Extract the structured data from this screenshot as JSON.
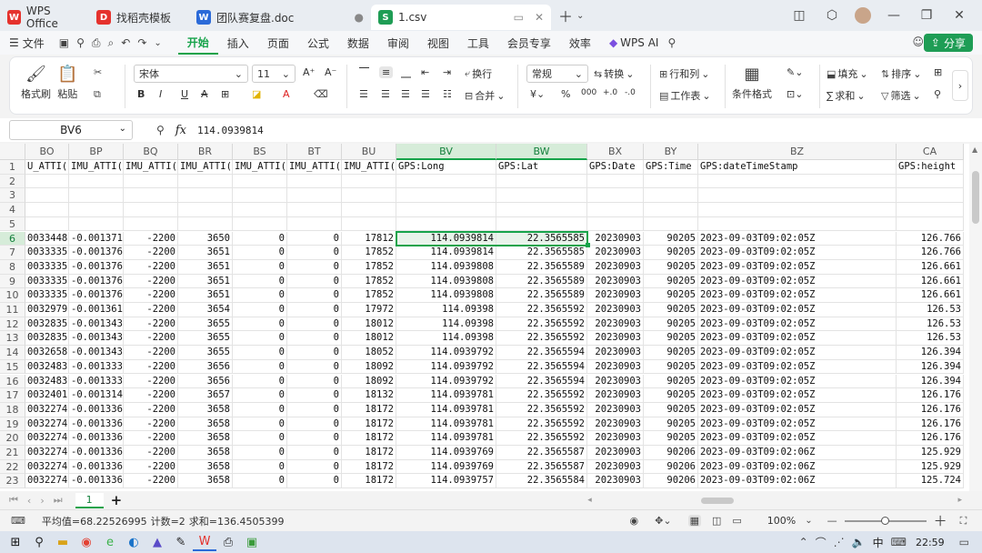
{
  "tabs": [
    {
      "label": "WPS Office",
      "logo": "W",
      "color": "#e5322d"
    },
    {
      "label": "找稻壳模板",
      "logo": "D",
      "color": "#e5322d"
    },
    {
      "label": "团队赛复盘.doc",
      "logo": "W",
      "color": "#2b6ad8"
    },
    {
      "label": "1.csv",
      "logo": "S",
      "color": "#1f9d55"
    }
  ],
  "menubar": {
    "file": "文件",
    "items": [
      "开始",
      "插入",
      "页面",
      "公式",
      "数据",
      "审阅",
      "视图",
      "工具",
      "会员专享",
      "效率"
    ],
    "wps_ai": "WPS AI",
    "share": "分享"
  },
  "ribbon": {
    "format_painter": "格式刷",
    "paste": "粘贴",
    "font_name": "宋体",
    "font_size": "11",
    "wrap": "换行",
    "merge": "合并",
    "number_format": "常规",
    "convert": "转换",
    "rows_cols": "行和列",
    "worksheet": "工作表",
    "cond_format": "条件格式",
    "fill": "填充",
    "sort": "排序",
    "sum": "求和",
    "filter": "筛选"
  },
  "formula": {
    "cell_ref": "BV6",
    "fx": "fx",
    "value": "114.0939814"
  },
  "grid": {
    "columns": [
      "BO",
      "BP",
      "BQ",
      "BR",
      "BS",
      "BT",
      "BU",
      "BV",
      "BW",
      "BX",
      "BY",
      "BZ",
      "CA"
    ],
    "header_row": [
      "U_ATTI(",
      "IMU_ATTI(",
      "IMU_ATTI(",
      "IMU_ATTI(",
      "IMU_ATTI(",
      "IMU_ATTI(",
      "IMU_ATTI(",
      "GPS:Long",
      "GPS:Lat",
      "GPS:Date",
      "GPS:Time",
      "GPS:dateTimeStamp",
      "GPS:height"
    ],
    "row_numbers": [
      "1",
      "2",
      "3",
      "4",
      "5",
      "6",
      "7",
      "8",
      "9",
      "10",
      "11",
      "12",
      "13",
      "14",
      "15",
      "16",
      "17",
      "18",
      "19",
      "20",
      "21",
      "22",
      "23"
    ],
    "rows": [
      [
        "0033448",
        "-0.001371",
        "-2200",
        "3650",
        "0",
        "0",
        "17812",
        "114.0939814",
        "22.3565585",
        "20230903",
        "90205",
        "2023-09-03T09:02:05Z",
        "126.766"
      ],
      [
        "0033335",
        "-0.001376",
        "-2200",
        "3651",
        "0",
        "0",
        "17852",
        "114.0939814",
        "22.3565585",
        "20230903",
        "90205",
        "2023-09-03T09:02:05Z",
        "126.766"
      ],
      [
        "0033335",
        "-0.001376",
        "-2200",
        "3651",
        "0",
        "0",
        "17852",
        "114.0939808",
        "22.3565589",
        "20230903",
        "90205",
        "2023-09-03T09:02:05Z",
        "126.661"
      ],
      [
        "0033335",
        "-0.001376",
        "-2200",
        "3651",
        "0",
        "0",
        "17852",
        "114.0939808",
        "22.3565589",
        "20230903",
        "90205",
        "2023-09-03T09:02:05Z",
        "126.661"
      ],
      [
        "0033335",
        "-0.001376",
        "-2200",
        "3651",
        "0",
        "0",
        "17852",
        "114.0939808",
        "22.3565589",
        "20230903",
        "90205",
        "2023-09-03T09:02:05Z",
        "126.661"
      ],
      [
        "0032979",
        "-0.001361",
        "-2200",
        "3654",
        "0",
        "0",
        "17972",
        "114.09398",
        "22.3565592",
        "20230903",
        "90205",
        "2023-09-03T09:02:05Z",
        "126.53"
      ],
      [
        "0032835",
        "-0.001343",
        "-2200",
        "3655",
        "0",
        "0",
        "18012",
        "114.09398",
        "22.3565592",
        "20230903",
        "90205",
        "2023-09-03T09:02:05Z",
        "126.53"
      ],
      [
        "0032835",
        "-0.001343",
        "-2200",
        "3655",
        "0",
        "0",
        "18012",
        "114.09398",
        "22.3565592",
        "20230903",
        "90205",
        "2023-09-03T09:02:05Z",
        "126.53"
      ],
      [
        "0032658",
        "-0.001343",
        "-2200",
        "3655",
        "0",
        "0",
        "18052",
        "114.0939792",
        "22.3565594",
        "20230903",
        "90205",
        "2023-09-03T09:02:05Z",
        "126.394"
      ],
      [
        "0032483",
        "-0.001333",
        "-2200",
        "3656",
        "0",
        "0",
        "18092",
        "114.0939792",
        "22.3565594",
        "20230903",
        "90205",
        "2023-09-03T09:02:05Z",
        "126.394"
      ],
      [
        "0032483",
        "-0.001333",
        "-2200",
        "3656",
        "0",
        "0",
        "18092",
        "114.0939792",
        "22.3565594",
        "20230903",
        "90205",
        "2023-09-03T09:02:05Z",
        "126.394"
      ],
      [
        "0032401",
        "-0.001314",
        "-2200",
        "3657",
        "0",
        "0",
        "18132",
        "114.0939781",
        "22.3565592",
        "20230903",
        "90205",
        "2023-09-03T09:02:05Z",
        "126.176"
      ],
      [
        "0032274",
        "-0.001336",
        "-2200",
        "3658",
        "0",
        "0",
        "18172",
        "114.0939781",
        "22.3565592",
        "20230903",
        "90205",
        "2023-09-03T09:02:05Z",
        "126.176"
      ],
      [
        "0032274",
        "-0.001336",
        "-2200",
        "3658",
        "0",
        "0",
        "18172",
        "114.0939781",
        "22.3565592",
        "20230903",
        "90205",
        "2023-09-03T09:02:05Z",
        "126.176"
      ],
      [
        "0032274",
        "-0.001336",
        "-2200",
        "3658",
        "0",
        "0",
        "18172",
        "114.0939781",
        "22.3565592",
        "20230903",
        "90205",
        "2023-09-03T09:02:05Z",
        "126.176"
      ],
      [
        "0032274",
        "-0.001336",
        "-2200",
        "3658",
        "0",
        "0",
        "18172",
        "114.0939769",
        "22.3565587",
        "20230903",
        "90206",
        "2023-09-03T09:02:06Z",
        "125.929"
      ],
      [
        "0032274",
        "-0.001336",
        "-2200",
        "3658",
        "0",
        "0",
        "18172",
        "114.0939769",
        "22.3565587",
        "20230903",
        "90206",
        "2023-09-03T09:02:06Z",
        "125.929"
      ],
      [
        "0032274",
        "-0.001336",
        "-2200",
        "3658",
        "0",
        "0",
        "18172",
        "114.0939757",
        "22.3565584",
        "20230903",
        "90206",
        "2023-09-03T09:02:06Z",
        "125.724"
      ]
    ]
  },
  "sheet": {
    "name": "1",
    "add": "+"
  },
  "status": {
    "avg": "平均值=68.22526995",
    "count": "计数=2",
    "sum": "求和=136.4505399",
    "zoom": "100%"
  },
  "taskbar": {
    "time": "22:59",
    "ime": "中"
  }
}
